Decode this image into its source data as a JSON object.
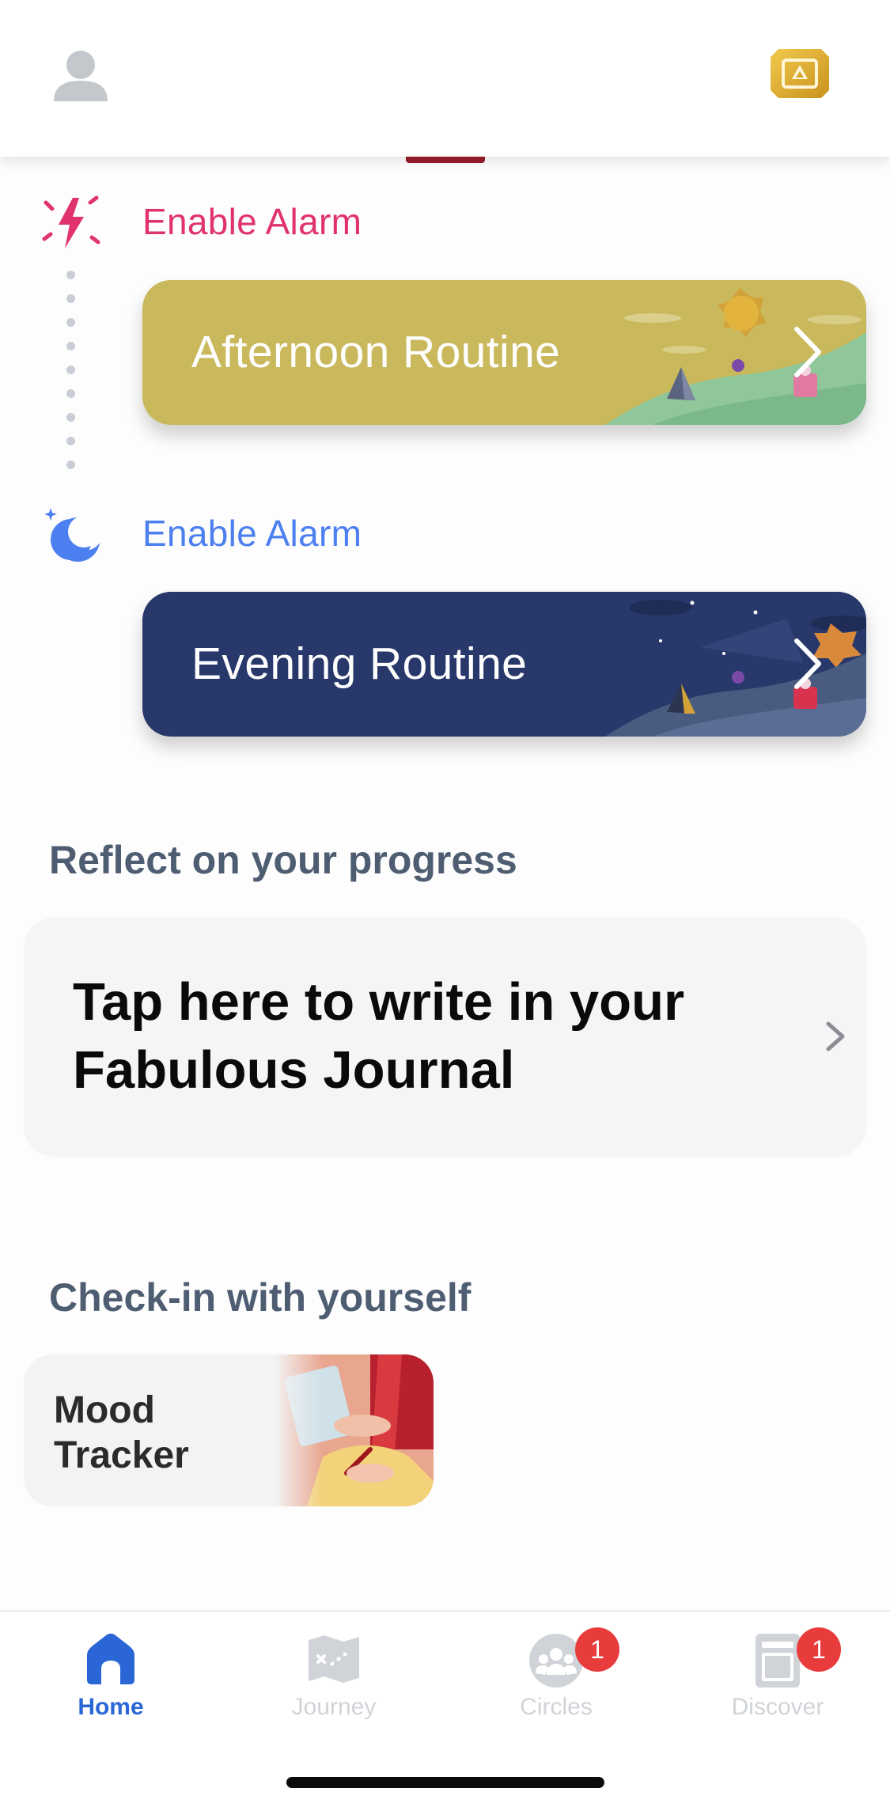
{
  "header": {
    "profile_icon": "person-icon",
    "premium_icon": "premium-ticket-icon"
  },
  "routines": [
    {
      "alarm_label": "Enable Alarm",
      "alarm_icon": "bolt-icon",
      "alarm_color": "#e0336c",
      "title": "Afternoon Routine",
      "card_color": "#c9b95c"
    },
    {
      "alarm_label": "Enable Alarm",
      "alarm_icon": "moon-icon",
      "alarm_color": "#4c7ff0",
      "title": "Evening Routine",
      "card_color": "#28386a"
    }
  ],
  "reflect": {
    "section_title": "Reflect on your progress",
    "journal_prompt": "Tap here to write in your Fabulous Journal"
  },
  "checkin": {
    "section_title": "Check-in with yourself",
    "mood_tracker_label": "Mood Tracker"
  },
  "nav": {
    "items": [
      {
        "label": "Home",
        "icon": "home-icon",
        "active": true
      },
      {
        "label": "Journey",
        "icon": "map-icon",
        "active": false
      },
      {
        "label": "Circles",
        "icon": "group-icon",
        "active": false,
        "badge": "1"
      },
      {
        "label": "Discover",
        "icon": "discover-icon",
        "active": false,
        "badge": "1"
      }
    ]
  }
}
